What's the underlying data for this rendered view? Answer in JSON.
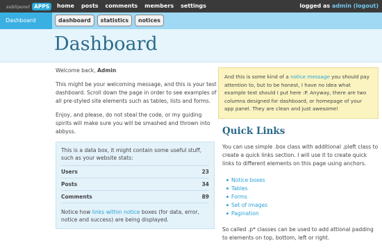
{
  "app": {
    "logo_text": "sublipanel",
    "logo_badge": "APPS"
  },
  "topnav": {
    "items": [
      "home",
      "posts",
      "comments",
      "members",
      "settings"
    ]
  },
  "user": {
    "prefix": "logged as",
    "name": "admin",
    "logout": "(logout)"
  },
  "subbar": {
    "section": "Dashboard",
    "tabs": [
      "dashboard",
      "statistics",
      "notices"
    ]
  },
  "page": {
    "title": "Dashboard"
  },
  "welcome": {
    "prefix": "Welcome back,",
    "name": "Admin"
  },
  "intro": {
    "p1": "This might be your welcoming message, and this is your test dashboard. Scroll down the page in order to see examples of all pre-styled site elements such as tables, lists and forms.",
    "p2": "Enjoy, and please, do not steal the code, or my guiding spirits will make sure you will be smashed and thrown into abbyss."
  },
  "databox": {
    "intro": "This is a data box, it might contain some useful stuff, such as your website stats:",
    "rows": [
      {
        "label": "Users",
        "value": "23"
      },
      {
        "label": "Posts",
        "value": "34"
      },
      {
        "label": "Comments",
        "value": "89"
      }
    ],
    "foot_before": "Notice how",
    "foot_link": "links within notice",
    "foot_after": "boxes (for data, error, notice and success) are being displayed."
  },
  "notice": {
    "before": "And this is some kind of a",
    "link": "notice message",
    "after": "you should pay attention to, but to be honest, I have no idea what example text should I put here :P. Anyway, there are two columns designed for dashboard, or homepage of your app panel. They are clean and just awesome!"
  },
  "quick": {
    "title": "Quick Links",
    "desc": "You can use simple .box class with additional .pleft class to create a quick links section. I will use it to create quick links to different elements on this page using anchors.",
    "links": [
      "Notice boxes",
      "Tables",
      "Forms",
      "Set of images",
      "Pagination"
    ],
    "foot": "So called .p* classes can be used to add attional padding to elements on top, bottom, left or right."
  }
}
